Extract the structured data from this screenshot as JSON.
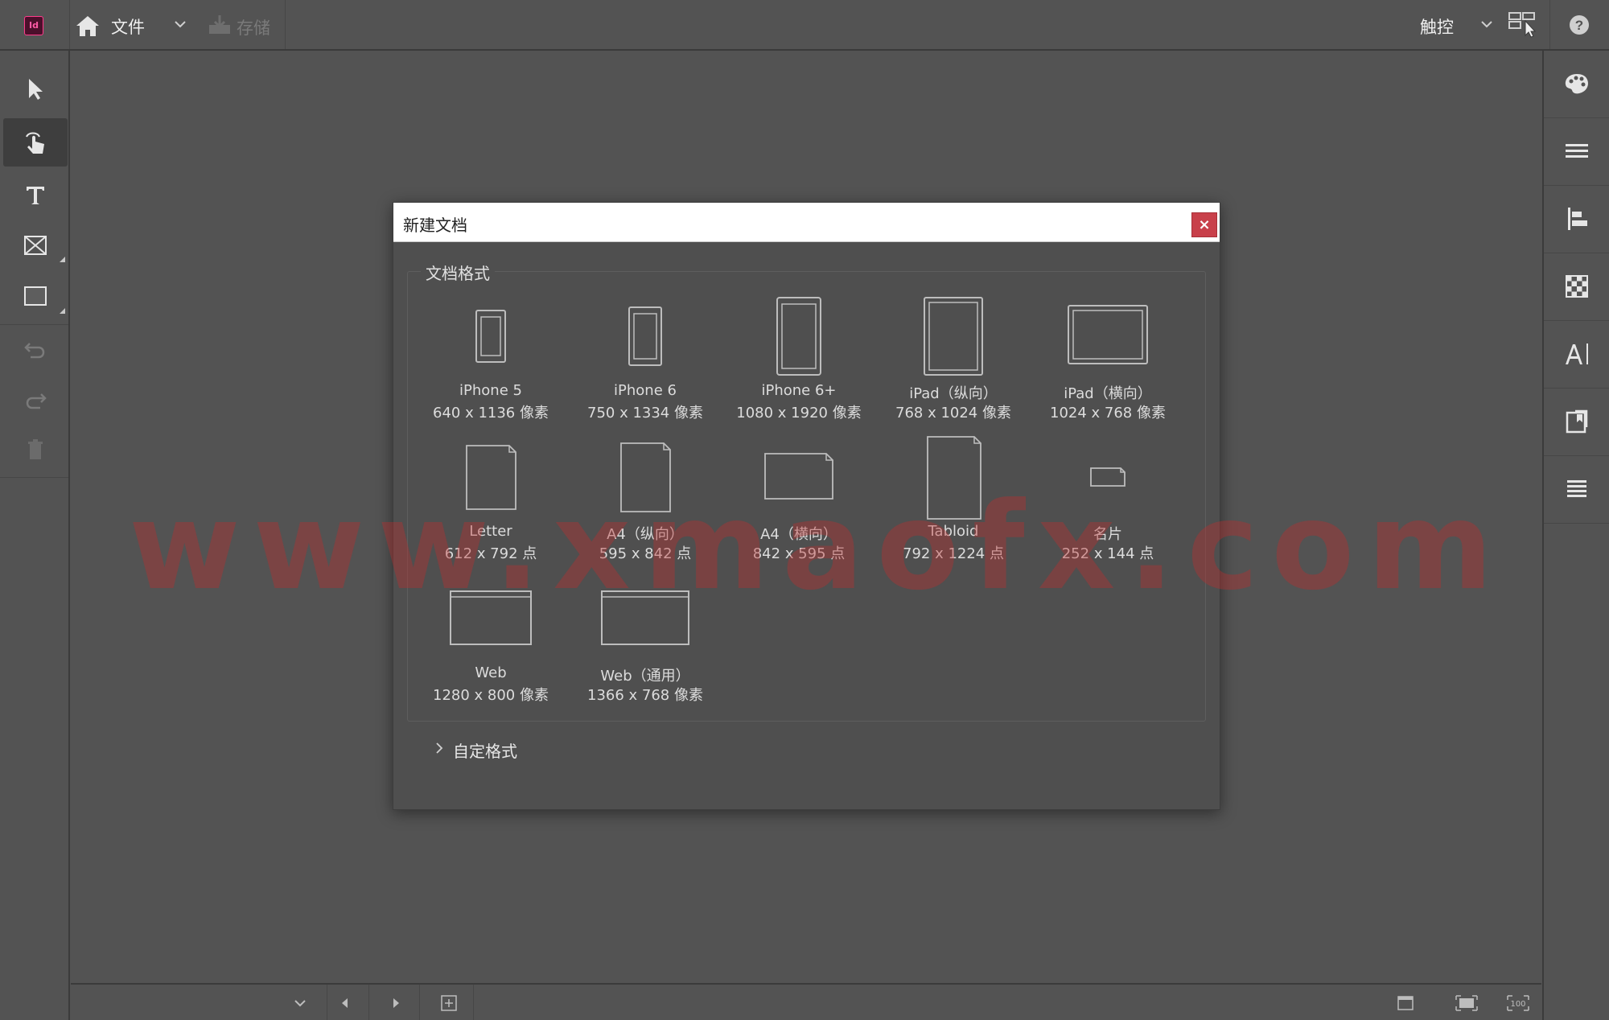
{
  "app": {
    "logo_text": "Id",
    "file_menu": "文件",
    "save_label": "存储",
    "touch_label": "触控"
  },
  "dialog": {
    "title": "新建文档",
    "close": "×",
    "group_label": "文档格式",
    "custom_label": "自定格式",
    "presets": [
      {
        "name": "iPhone 5",
        "size": "640 x 1136 像素",
        "icon": "phone-portrait-icon"
      },
      {
        "name": "iPhone 6",
        "size": "750 x 1334 像素",
        "icon": "phone-portrait-icon"
      },
      {
        "name": "iPhone 6+",
        "size": "1080 x 1920 像素",
        "icon": "phone-portrait-icon"
      },
      {
        "name": "iPad（纵向）",
        "size": "768 x 1024 像素",
        "icon": "tablet-portrait-icon"
      },
      {
        "name": "iPad（横向）",
        "size": "1024 x 768 像素",
        "icon": "tablet-landscape-icon"
      },
      {
        "name": "Letter",
        "size": "612 x 792 点",
        "icon": "page-portrait-icon"
      },
      {
        "name": "A4（纵向）",
        "size": "595 x 842 点",
        "icon": "page-portrait-icon"
      },
      {
        "name": "A4（横向）",
        "size": "842 x 595 点",
        "icon": "page-landscape-icon"
      },
      {
        "name": "Tabloid",
        "size": "792 x 1224 点",
        "icon": "page-portrait-icon"
      },
      {
        "name": "名片",
        "size": "252 x 144 点",
        "icon": "card-icon"
      },
      {
        "name": "Web",
        "size": "1280 x 800 像素",
        "icon": "screen-landscape-icon"
      },
      {
        "name": "Web（通用）",
        "size": "1366 x 768 像素",
        "icon": "screen-landscape-icon"
      }
    ]
  },
  "watermark": "www.xmaofx.com",
  "colors": {
    "background": "#535353",
    "dialog_bg": "#4f4f4f",
    "close_button": "#c8404a",
    "logo_fill": "#4b0f2b",
    "logo_accent": "#ff3a8a",
    "watermark": "#be2d2d"
  }
}
